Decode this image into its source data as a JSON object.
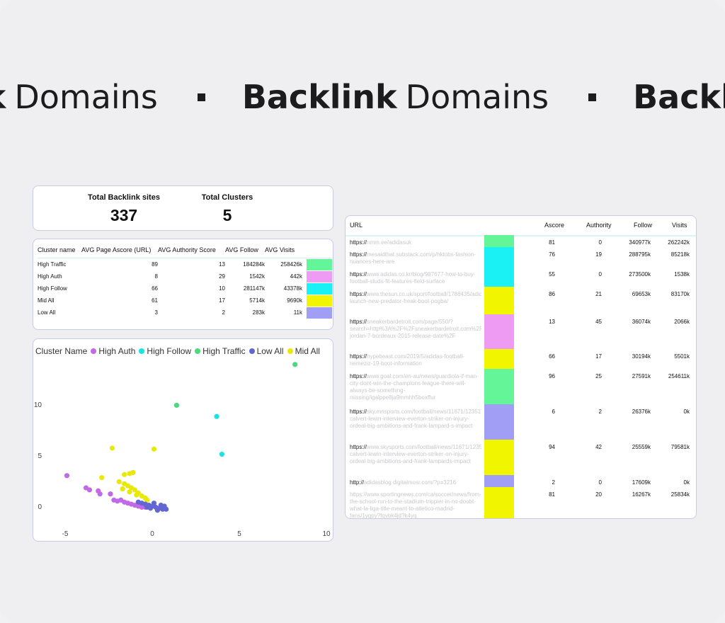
{
  "marquee": {
    "items": [
      {
        "bold": "nk",
        "rest": "Domains"
      },
      {
        "bold": "Backlink",
        "rest": "Domains"
      },
      {
        "bold": "Backl",
        "rest": ""
      }
    ]
  },
  "kpi": {
    "sites_label": "Total Backlink sites",
    "sites_value": "337",
    "clusters_label": "Total Clusters",
    "clusters_value": "5"
  },
  "cluster_table": {
    "headers": [
      "Cluster name",
      "AVG Page Ascore (URL)",
      "AVG Authority Score",
      "AVG Follow",
      "AVG Visits"
    ],
    "rows": [
      {
        "name": "High Traffic",
        "ascore": "89",
        "authority": "13",
        "follow": "184284k",
        "visits": "258426k",
        "color": "#63f598"
      },
      {
        "name": "High Auth",
        "ascore": "8",
        "authority": "29",
        "follow": "1542k",
        "visits": "442k",
        "color": "#ee9cf3"
      },
      {
        "name": "High Follow",
        "ascore": "66",
        "authority": "10",
        "follow": "281147k",
        "visits": "43378k",
        "color": "#19f1f5"
      },
      {
        "name": "Mid All",
        "ascore": "61",
        "authority": "17",
        "follow": "5714k",
        "visits": "9690k",
        "color": "#f2f500"
      },
      {
        "name": "Low All",
        "ascore": "3",
        "authority": "2",
        "follow": "283k",
        "visits": "11k",
        "color": "#a09ff5"
      }
    ]
  },
  "scatter": {
    "legend_title": "Cluster Name",
    "legend": [
      {
        "name": "High Auth",
        "color": "#c169e6"
      },
      {
        "name": "High Follow",
        "color": "#1ee3dc"
      },
      {
        "name": "High Traffic",
        "color": "#4ad97e"
      },
      {
        "name": "Low All",
        "color": "#6366d1"
      },
      {
        "name": "Mid All",
        "color": "#e8e80a"
      }
    ]
  },
  "chart_data": {
    "type": "scatter",
    "xlim": [
      -5.5,
      10
    ],
    "ylim": [
      -2,
      14
    ],
    "xticks": [
      "-5",
      "0",
      "5",
      "10"
    ],
    "yticks": [
      "0",
      "5",
      "10"
    ],
    "series": [
      {
        "name": "High Traffic",
        "color": "#4ad97e",
        "points": [
          [
            8.2,
            13.9
          ],
          [
            1.4,
            9.9
          ]
        ]
      },
      {
        "name": "High Follow",
        "color": "#1ee3dc",
        "points": [
          [
            3.7,
            8.8
          ],
          [
            4.0,
            5.1
          ]
        ]
      },
      {
        "name": "High Auth",
        "color": "#c169e6",
        "points": [
          [
            -4.9,
            3.0
          ],
          [
            -3.8,
            1.8
          ],
          [
            -3.6,
            1.6
          ],
          [
            -3.1,
            1.5
          ],
          [
            -2.4,
            1.2
          ],
          [
            -3.0,
            1.2
          ],
          [
            -2.2,
            0.6
          ],
          [
            -2.0,
            0.5
          ],
          [
            -1.8,
            0.6
          ],
          [
            -1.6,
            0.4
          ],
          [
            -1.4,
            0.3
          ],
          [
            -1.2,
            0.2
          ],
          [
            -1.0,
            0.1
          ],
          [
            -0.8,
            0.0
          ],
          [
            -0.6,
            -0.1
          ],
          [
            -0.4,
            -0.1
          ]
        ]
      },
      {
        "name": "Mid All",
        "color": "#e8e80a",
        "points": [
          [
            -2.3,
            5.7
          ],
          [
            0.1,
            5.6
          ],
          [
            -2.9,
            2.8
          ],
          [
            -1.6,
            3.1
          ],
          [
            -1.3,
            3.2
          ],
          [
            -1.1,
            3.3
          ],
          [
            -1.9,
            2.4
          ],
          [
            -1.6,
            2.2
          ],
          [
            -1.4,
            2.0
          ],
          [
            -1.2,
            1.8
          ],
          [
            -1.0,
            1.6
          ],
          [
            -0.8,
            1.3
          ],
          [
            -0.6,
            1.0
          ],
          [
            -0.4,
            0.8
          ],
          [
            -0.3,
            0.6
          ],
          [
            -1.7,
            1.7
          ],
          [
            -1.3,
            1.4
          ],
          [
            -0.9,
            1.1
          ]
        ]
      },
      {
        "name": "Low All",
        "color": "#6366d1",
        "points": [
          [
            -0.8,
            0.4
          ],
          [
            -0.6,
            0.3
          ],
          [
            -0.4,
            0.2
          ],
          [
            -0.2,
            0.1
          ],
          [
            0.0,
            0.0
          ],
          [
            0.2,
            -0.1
          ],
          [
            0.4,
            -0.2
          ],
          [
            0.6,
            -0.3
          ],
          [
            0.8,
            -0.3
          ],
          [
            0.7,
            0.0
          ],
          [
            0.3,
            -0.4
          ],
          [
            -0.1,
            -0.2
          ],
          [
            -0.3,
            -0.1
          ],
          [
            0.1,
            0.3
          ],
          [
            0.5,
            0.1
          ]
        ]
      }
    ]
  },
  "url_table": {
    "headers": {
      "url": "URL",
      "ascore": "Ascore",
      "authority": "Authority",
      "follow": "Follow",
      "visits": "Visits"
    },
    "rows": [
      {
        "prefix": "https://",
        "rest": "nmm.ee/adidasuk",
        "color": "#63f598",
        "ascore": "81",
        "authority": "0",
        "follow": "340977k",
        "visits": "262242k"
      },
      {
        "prefix": "https://",
        "rest": "mesaidthat.substack.com/p/hktobs-fashion-nuances-here-are",
        "color": "#19f1f5",
        "ascore": "76",
        "authority": "19",
        "follow": "288795k",
        "visits": "85218k"
      },
      {
        "prefix": "https://",
        "rest": "www.adidas.co.kr/blog/987677-how-to-buy-football-studs-fit-features-field-surface",
        "color": "#19f1f5",
        "ascore": "55",
        "authority": "0",
        "follow": "273500k",
        "visits": "1538k"
      },
      {
        "prefix": "https://",
        "rest": "www.thesun.co.uk/sport/football/1786435/adidas-launch-new-predator-freak-boot-pogba/",
        "color": "#f2f500",
        "ascore": "86",
        "authority": "21",
        "follow": "69653k",
        "visits": "83170k"
      },
      {
        "prefix": "https://",
        "rest": "sneakerbardetroit.com/page/550/?search=http%3A%2F%2Fsneakerbardetroit.com%2Fair-jordan-7-bordeaux-2015-release-date%2F",
        "color": "#ee9cf3",
        "ascore": "13",
        "authority": "45",
        "follow": "36074k",
        "visits": "2066k"
      },
      {
        "prefix": "https://",
        "rest": "hypebeast.com/2019/5/adidas-football-nemeziz-19-boot-information",
        "color": "#f2f500",
        "ascore": "66",
        "authority": "17",
        "follow": "30194k",
        "visits": "5501k"
      },
      {
        "prefix": "https://",
        "rest": "www.goal.com/en-au/news/guardiola-if-man-city-dont-win-the-champions-league-there-will-always-be-something-missing/igalppe8ja9mmhh5boxffur",
        "color": "#63f598",
        "ascore": "96",
        "authority": "25",
        "follow": "27591k",
        "visits": "254611k"
      },
      {
        "prefix": "https://",
        "rest": "sky.mnsports.com/football/news/11671/12351733/dominic-calvert-lewin-interview-everton-striker-on-injury-ordeal-big-ambitions-and-frank-lampard-s-impact",
        "color": "#a09ff5",
        "ascore": "6",
        "authority": "2",
        "follow": "26376k",
        "visits": "0k"
      },
      {
        "prefix": "https://",
        "rest": "www.skysports.com/football/news/11671/12351733/dominic-calvert-lewin-interview-everton-striker-on-injury-ordeal-big-ambitions-and-frank-lampards-impact",
        "color": "#f2f500",
        "ascore": "94",
        "authority": "42",
        "follow": "25559k",
        "visits": "79581k"
      },
      {
        "prefix": "http://",
        "rest": "adidasblog.digitalmosr.com/?p=3216",
        "color": "#a09ff5",
        "ascore": "2",
        "authority": "0",
        "follow": "17609k",
        "visits": "0k"
      },
      {
        "prefix": "",
        "rest": "https://www.sportingnews.com/ca/soccer/news/from-the-school-run-to-the-stadium-trippier-in-no-doubt-what-la-liga-title-meant-to-atletico-madrid-fans/1ygpy?fqvbk4jd?k4yq",
        "color": "#f2f500",
        "ascore": "81",
        "authority": "20",
        "follow": "16267k",
        "visits": "25834k"
      }
    ]
  }
}
